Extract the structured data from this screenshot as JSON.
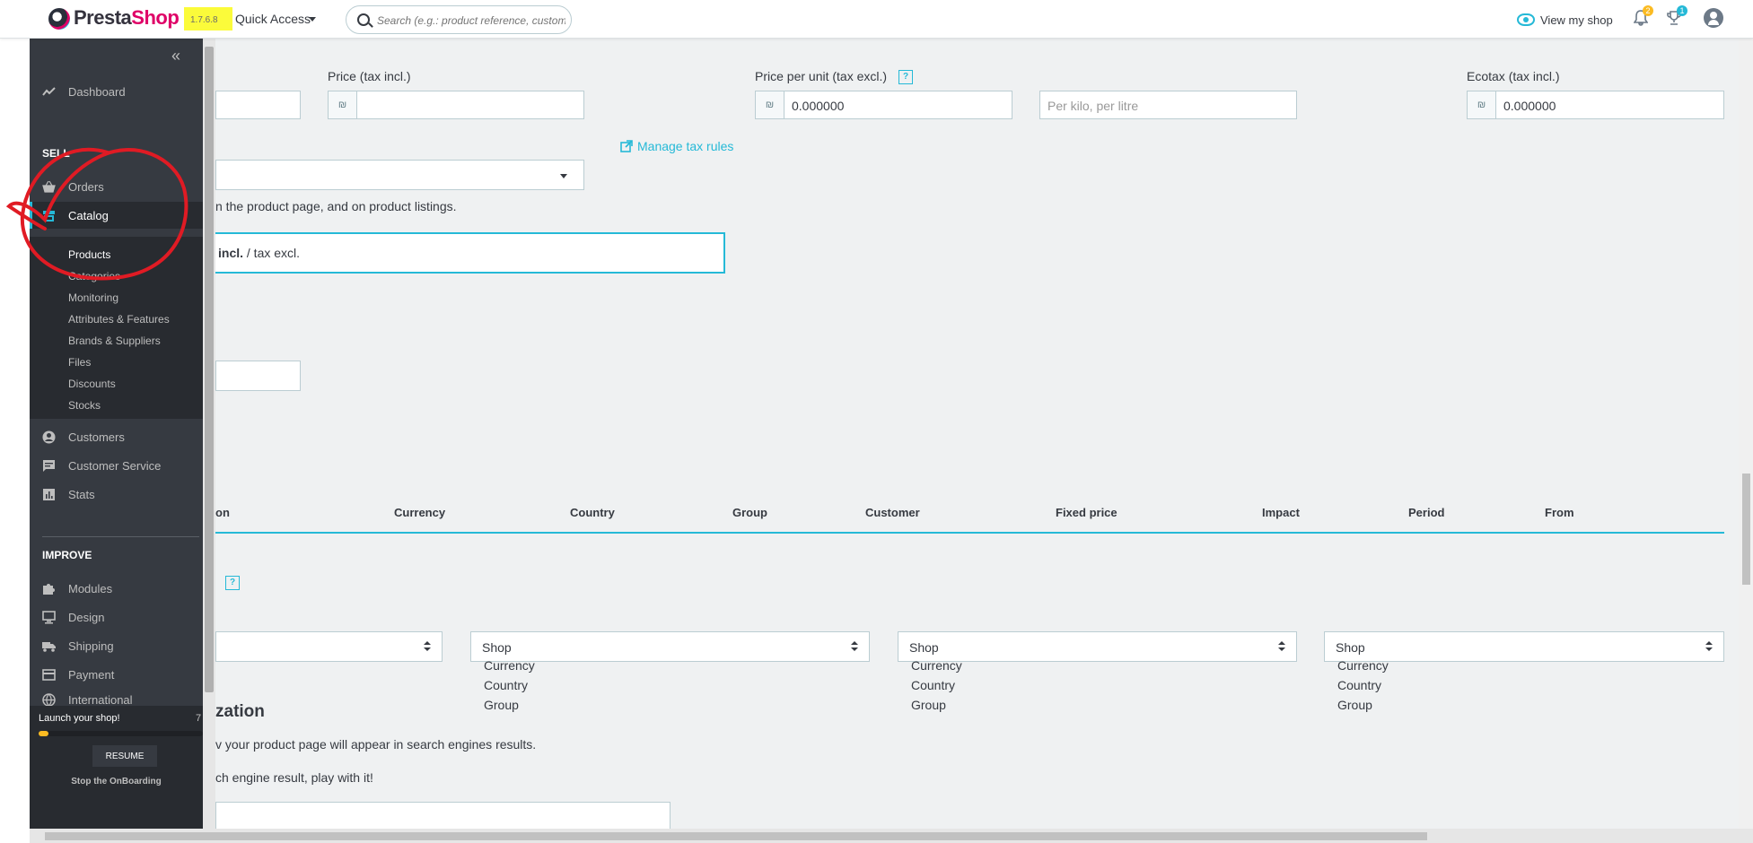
{
  "header": {
    "logo_presta": "Presta",
    "logo_shop": "Shop",
    "version": "1.7.6.8",
    "quick_access": "Quick Access",
    "search_placeholder": "Search (e.g.: product reference, customer name…)",
    "view_my_shop": "View my shop",
    "notifications_count": "2",
    "trophy_count": "1"
  },
  "sidebar": {
    "collapse": "«",
    "dashboard": "Dashboard",
    "sell_title": "SELL",
    "orders": "Orders",
    "catalog": "Catalog",
    "catalog_sub": [
      "Products",
      "Categories",
      "Monitoring",
      "Attributes & Features",
      "Brands & Suppliers",
      "Files",
      "Discounts",
      "Stocks"
    ],
    "customers": "Customers",
    "customer_service": "Customer Service",
    "stats": "Stats",
    "improve_title": "IMPROVE",
    "modules": "Modules",
    "design": "Design",
    "shipping": "Shipping",
    "payment": "Payment",
    "international": "International",
    "launch_title": "Launch your shop!",
    "launch_pct": "7",
    "launch_progress": 0.06,
    "resume": "RESUME",
    "stop_onboarding": "Stop the OnBoarding"
  },
  "main": {
    "price_incl_label": "Price (tax incl.)",
    "currency_symbol": "₪",
    "price_per_unit_label": "Price per unit (tax excl.)",
    "price_per_unit_value": "0.000000",
    "unit_placeholder": "Per kilo, per litre",
    "ecotax_label": "Ecotax (tax incl.)",
    "ecotax_value": "0.000000",
    "manage_tax_rules": "Manage tax rules",
    "listing_note": "n the product page, and on product listings.",
    "tax_bold": "incl.",
    "tax_rest": " / tax excl.",
    "help_mark": "?",
    "table_headers": [
      "on",
      "Currency",
      "Country",
      "Group",
      "Customer",
      "Fixed price",
      "Impact",
      "Period",
      "From"
    ],
    "shop_label": "Shop",
    "priority_options": [
      "Currency",
      "Country",
      "Group"
    ],
    "seo_title": "zation",
    "seo_line1": "v your product page will appear in search engines results.",
    "seo_line2": "ch engine result, play with it!"
  }
}
